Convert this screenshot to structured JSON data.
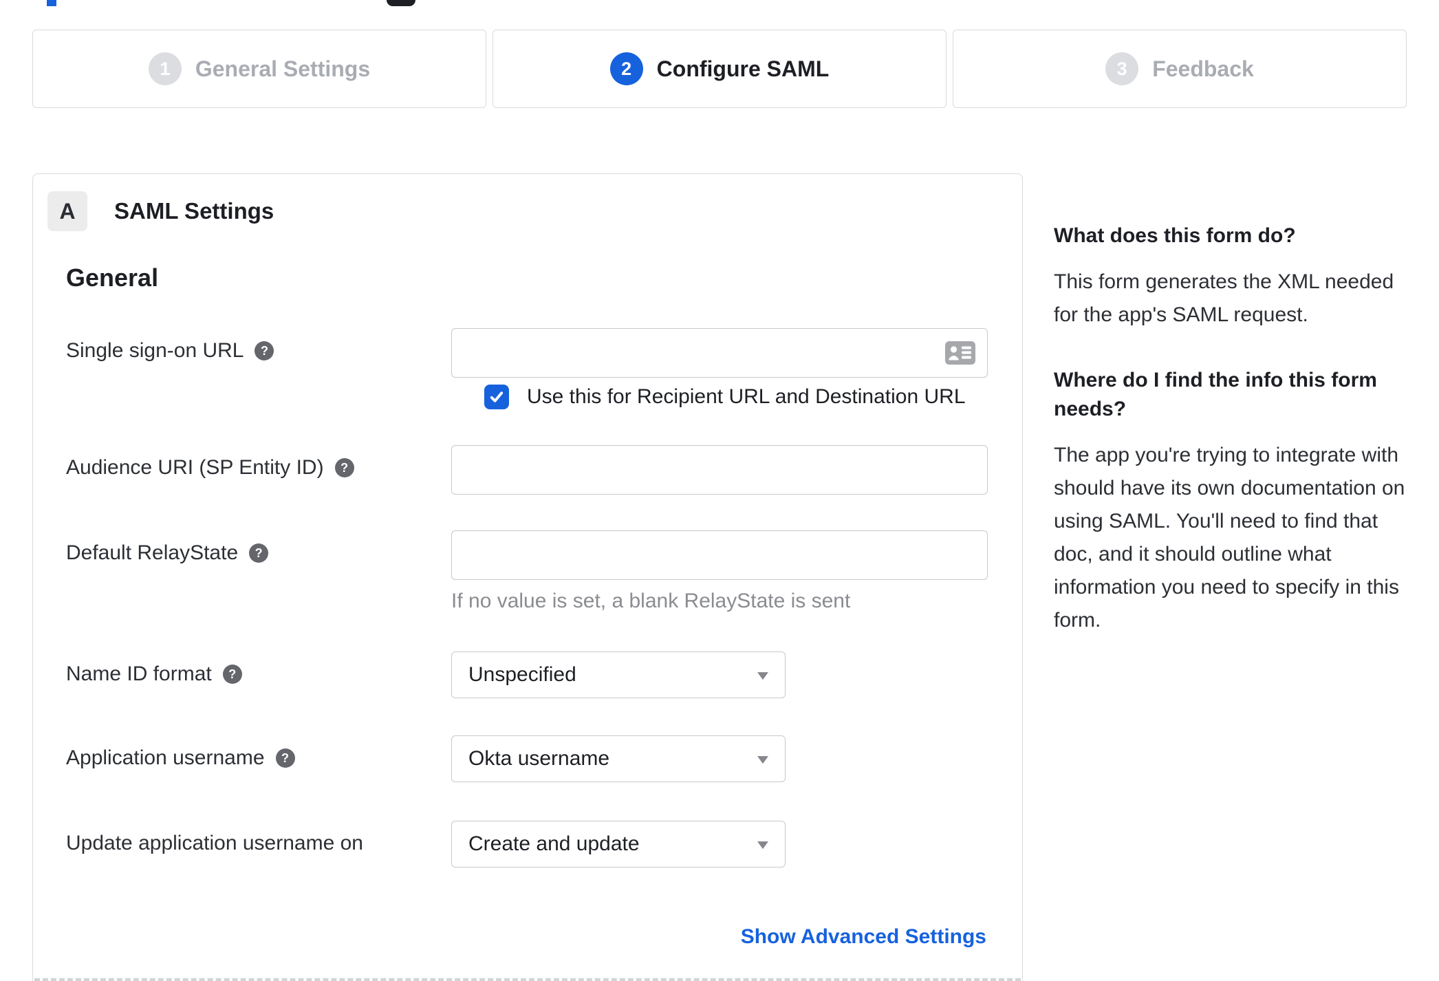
{
  "page": {
    "accent_color": "#1662dd",
    "background_color": "#ffffff"
  },
  "stepper": {
    "steps": [
      {
        "number": "1",
        "label": "General Settings",
        "state": "inactive"
      },
      {
        "number": "2",
        "label": "Configure SAML",
        "state": "active"
      },
      {
        "number": "3",
        "label": "Feedback",
        "state": "inactive"
      }
    ]
  },
  "panel": {
    "section_letter": "A",
    "section_title": "SAML Settings",
    "group_title": "General",
    "fields": {
      "sso_url": {
        "label": "Single sign-on URL",
        "value": "",
        "placeholder": "",
        "checkbox": {
          "checked": true,
          "label": "Use this for Recipient URL and Destination URL"
        }
      },
      "audience_uri": {
        "label": "Audience URI (SP Entity ID)",
        "value": "",
        "placeholder": ""
      },
      "relay_state": {
        "label": "Default RelayState",
        "value": "",
        "placeholder": "",
        "hint": "If no value is set, a blank RelayState is sent"
      },
      "name_id_format": {
        "label": "Name ID format",
        "value": "Unspecified"
      },
      "app_username": {
        "label": "Application username",
        "value": "Okta username"
      },
      "update_app_username": {
        "label": "Update application username on",
        "value": "Create and update"
      }
    },
    "advanced_link": "Show Advanced Settings"
  },
  "sidebar": {
    "blocks": [
      {
        "heading": "What does this form do?",
        "body": "This form generates the XML needed for the app's SAML request."
      },
      {
        "heading": "Where do I find the info this form needs?",
        "body": "The app you're trying to integrate with should have its own documentation on using SAML. You'll need to find that doc, and it should outline what information you need to specify in this form."
      }
    ]
  }
}
